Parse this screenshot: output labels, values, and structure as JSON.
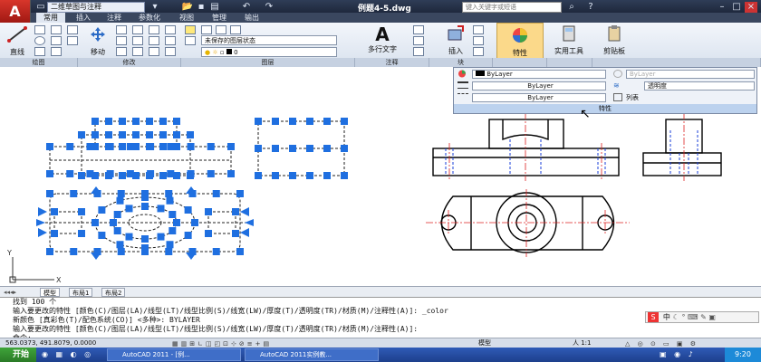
{
  "titlebar": {
    "app_icon": "A",
    "workspace": "二维草图与注释",
    "doc_title": "例题4-5.dwg",
    "search_placeholder": "键入关键字或短语"
  },
  "tabs": [
    "常用",
    "插入",
    "注释",
    "参数化",
    "视图",
    "管理",
    "输出"
  ],
  "ribbon": {
    "draw_line": "直线",
    "modify_move": "移动",
    "layer_state": "未保存的图层状态",
    "layer_current": "0",
    "mtext": "多行文字",
    "insert": "插入",
    "properties": "特性",
    "utilities": "实用工具",
    "clipboard": "剪贴板",
    "block_label": "块",
    "panels": [
      "绘图",
      "修改",
      "图层",
      "注释",
      "块",
      "",
      "",
      ""
    ]
  },
  "properties_panel": {
    "color": "ByLayer",
    "linetype": "ByLayer",
    "lineweight": "ByLayer",
    "plotstyle": "ByLayer",
    "transparency": "透明度",
    "list": "列表",
    "footer": "特性"
  },
  "model_tabs": [
    "模型",
    "布局1",
    "布局2"
  ],
  "command_lines": [
    "找到 100 个",
    "输入要更改的特性 [颜色(C)/图层(LA)/线型(LT)/线型比例(S)/线宽(LW)/厚度(T)/透明度(TR)/材质(M)/注释性(A)]: _color",
    "新颜色 [真彩色(T)/配色系统(CO)] <多种>: BYLAYER",
    "输入要更改的特性 [颜色(C)/图层(LA)/线型(LT)/线型比例(S)/线宽(LW)/厚度(T)/透明度(TR)/材质(M)/注释性(A)]:",
    "命令:"
  ],
  "status": {
    "coords": "563.0373, 491.8079, 0.0000",
    "model": "模型",
    "scale": "人 1:1",
    "ime": "中"
  },
  "taskbar": {
    "start": "开始",
    "items": [
      "AutoCAD 2011 - [例...",
      "AutoCAD 2011实例教..."
    ],
    "clock": "9:20"
  },
  "ucs": {
    "y": "Y",
    "x": "X"
  },
  "colors": {
    "selection_blue": "#1f6fe0",
    "center_red": "#d22",
    "hidden_blue": "#1a3fd8"
  }
}
